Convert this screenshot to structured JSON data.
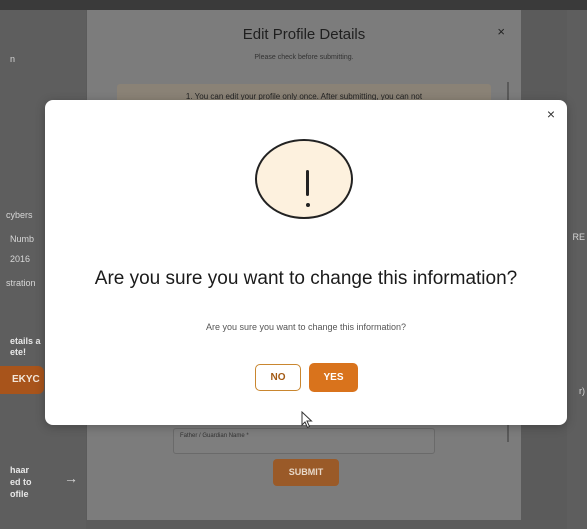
{
  "background_page": {
    "left_items": [
      "n",
      "cybers",
      "Numb",
      "2016",
      "stration",
      "etails a",
      "ete!",
      "haar",
      "ed to",
      "ofile"
    ],
    "ekyc_label": "EKYC",
    "arrow": "→",
    "right_items": [
      "RE",
      "r)"
    ]
  },
  "edit_sheet": {
    "title": "Edit Profile Details",
    "subtitle": "Please check before submitting.",
    "notice": "1. You can edit your profile only once. After submitting, you can not",
    "field_label": "Father / Guardian Name *",
    "submit_label": "SUBMIT",
    "close_glyph": "×"
  },
  "dialog": {
    "close_glyph": "×",
    "icon": "exclamation-icon",
    "title": "Are you sure you want to change this information?",
    "message": "Are you sure you want to change this information?",
    "no_label": "NO",
    "yes_label": "YES"
  },
  "colors": {
    "accent": "#d9731c",
    "accent_border": "#c9862f",
    "icon_fill": "#fdf1de"
  }
}
